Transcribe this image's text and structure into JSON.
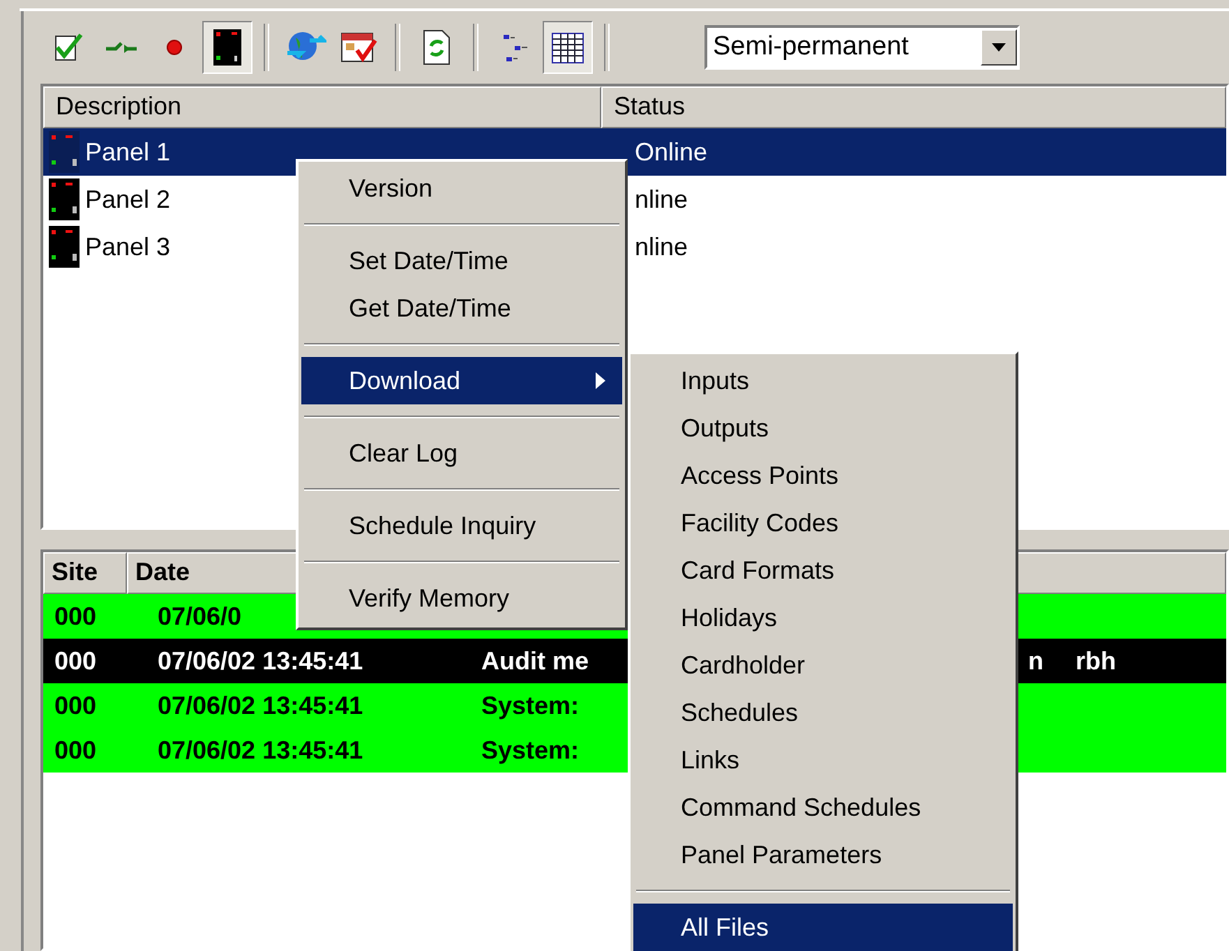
{
  "toolbar": {
    "buttons": [
      {
        "kind": "check",
        "pressed": false
      },
      {
        "kind": "connector",
        "pressed": false
      },
      {
        "kind": "dot",
        "pressed": false
      },
      {
        "kind": "panel",
        "pressed": true
      },
      {
        "kind": "globe",
        "pressed": false
      },
      {
        "kind": "calendar",
        "pressed": false
      },
      {
        "kind": "refresh",
        "pressed": false
      },
      {
        "kind": "tree",
        "pressed": false
      },
      {
        "kind": "grid",
        "pressed": true
      }
    ],
    "dropdown": {
      "value": "Semi-permanent"
    }
  },
  "panel_list": {
    "columns": [
      "Description",
      "Status"
    ],
    "rows": [
      {
        "description": "Panel 1",
        "status": "Online",
        "selected": true
      },
      {
        "description": "Panel 2",
        "status": "nline",
        "selected": false
      },
      {
        "description": "Panel 3",
        "status": "nline",
        "selected": false
      }
    ]
  },
  "log": {
    "columns": [
      "Site",
      "Date"
    ],
    "rows": [
      {
        "color": "#00ff00",
        "cells": [
          "000",
          "07/06/0"
        ]
      },
      {
        "color": "#000000",
        "cells": [
          "000",
          "07/06/02 13:45:41",
          "Audit me",
          "n",
          "rbh"
        ]
      },
      {
        "color": "#00ff00",
        "cells": [
          "000",
          "07/06/02 13:45:41",
          "System:"
        ]
      },
      {
        "color": "#00ff00",
        "cells": [
          "000",
          "07/06/02 13:45:41",
          "System:"
        ]
      }
    ]
  },
  "context_menu": {
    "items": [
      {
        "kind": "item",
        "label": "Version",
        "selected": false,
        "submenu": false
      },
      {
        "kind": "separator"
      },
      {
        "kind": "item",
        "label": "Set Date/Time",
        "selected": false,
        "submenu": false
      },
      {
        "kind": "item",
        "label": "Get Date/Time",
        "selected": false,
        "submenu": false
      },
      {
        "kind": "separator"
      },
      {
        "kind": "item",
        "label": "Download",
        "selected": true,
        "submenu": true
      },
      {
        "kind": "separator"
      },
      {
        "kind": "item",
        "label": "Clear Log",
        "selected": false,
        "submenu": false
      },
      {
        "kind": "separator"
      },
      {
        "kind": "item",
        "label": "Schedule Inquiry",
        "selected": false,
        "submenu": false
      },
      {
        "kind": "separator"
      },
      {
        "kind": "item",
        "label": "Verify Memory",
        "selected": false,
        "submenu": false
      }
    ]
  },
  "submenu": {
    "items": [
      {
        "kind": "item",
        "label": "Inputs",
        "selected": false
      },
      {
        "kind": "item",
        "label": "Outputs",
        "selected": false
      },
      {
        "kind": "item",
        "label": "Access Points",
        "selected": false
      },
      {
        "kind": "item",
        "label": "Facility Codes",
        "selected": false
      },
      {
        "kind": "item",
        "label": "Card Formats",
        "selected": false
      },
      {
        "kind": "item",
        "label": "Holidays",
        "selected": false
      },
      {
        "kind": "item",
        "label": "Cardholder",
        "selected": false
      },
      {
        "kind": "item",
        "label": "Schedules",
        "selected": false
      },
      {
        "kind": "item",
        "label": "Links",
        "selected": false
      },
      {
        "kind": "item",
        "label": "Command Schedules",
        "selected": false
      },
      {
        "kind": "item",
        "label": "Panel Parameters",
        "selected": false
      },
      {
        "kind": "separator"
      },
      {
        "kind": "item",
        "label": "All Files",
        "selected": true
      }
    ]
  }
}
